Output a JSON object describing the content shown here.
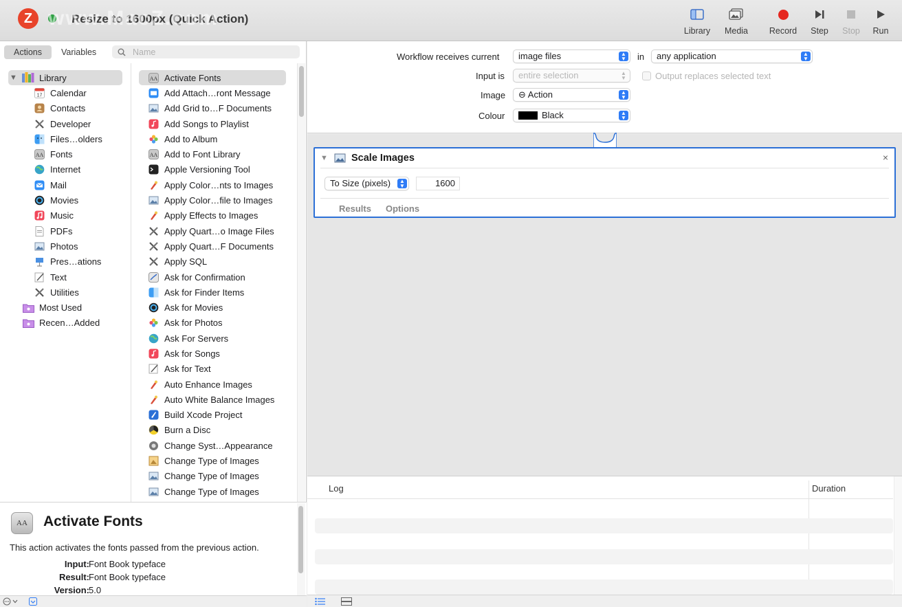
{
  "window": {
    "title": "Resize to 1600px (Quick Action)",
    "watermark_logo": "Z",
    "watermark": "www.MacZ.com"
  },
  "toolbar": {
    "library": "Library",
    "media": "Media",
    "record": "Record",
    "step": "Step",
    "stop": "Stop",
    "run": "Run"
  },
  "left": {
    "tabs": [
      "Actions",
      "Variables"
    ],
    "search_placeholder": "Name",
    "library_root": "Library",
    "library_items": [
      "Calendar",
      "Contacts",
      "Developer",
      "Files…olders",
      "Fonts",
      "Internet",
      "Mail",
      "Movies",
      "Music",
      "PDFs",
      "Photos",
      "Pres…ations",
      "Text",
      "Utilities"
    ],
    "smart_groups": [
      "Most Used",
      "Recen…Added"
    ],
    "actions": [
      "Activate Fonts",
      "Add Attach…ront Message",
      "Add Grid to…F Documents",
      "Add Songs to Playlist",
      "Add to Album",
      "Add to Font Library",
      "Apple Versioning Tool",
      "Apply Color…nts to Images",
      "Apply Color…file to Images",
      "Apply Effects to Images",
      "Apply Quart…o Image Files",
      "Apply Quart…F Documents",
      "Apply SQL",
      "Ask for Confirmation",
      "Ask for Finder Items",
      "Ask for Movies",
      "Ask for Photos",
      "Ask For Servers",
      "Ask for Songs",
      "Ask for Text",
      "Auto Enhance Images",
      "Auto White Balance Images",
      "Build Xcode Project",
      "Burn a Disc",
      "Change Syst…Appearance",
      "Change Type of Images",
      "Change Type of Images",
      "Change Type of Images"
    ]
  },
  "description": {
    "icon_text": "AA",
    "title": "Activate Fonts",
    "text": "This action activates the fonts passed from the previous action.",
    "input_label": "Input:",
    "input_value": "Font Book typeface",
    "result_label": "Result:",
    "result_value": "Font Book typeface",
    "version_label": "Version:",
    "version_value": "5.0"
  },
  "workflow": {
    "receives_label": "Workflow receives current",
    "receives_value": "image files",
    "in_label": "in",
    "app_value": "any application",
    "input_is_label": "Input is",
    "input_is_value": "entire selection",
    "output_replaces": "Output replaces selected text",
    "image_label": "Image",
    "image_value": "⊖ Action",
    "colour_label": "Colour",
    "colour_value": "Black"
  },
  "card": {
    "title": "Scale Images",
    "mode": "To Size (pixels)",
    "size_value": "1600",
    "tab_results": "Results",
    "tab_options": "Options",
    "close": "×"
  },
  "log": {
    "col_log": "Log",
    "col_duration": "Duration"
  },
  "colors": {
    "accent": "#2f7cf6",
    "record": "#e5271f",
    "card_border": "#2b6fd6"
  }
}
